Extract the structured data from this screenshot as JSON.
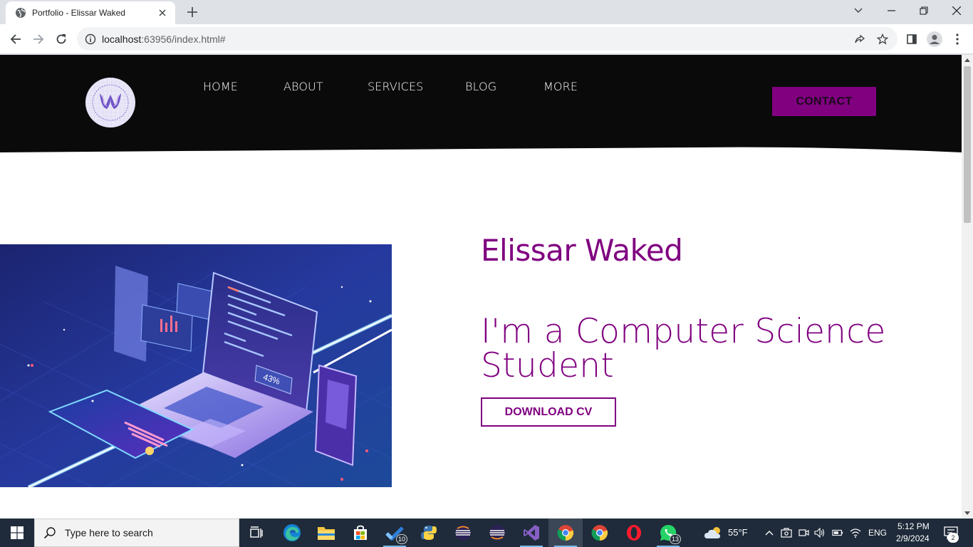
{
  "browser": {
    "tab_title": "Portfolio - Elissar Waked",
    "url_host": "localhost",
    "url_rest": ":63956/index.html#"
  },
  "site": {
    "nav": [
      "HOME",
      "ABOUT",
      "SERVICES",
      "BLOG",
      "MORE"
    ],
    "contact_label": "CONTACT",
    "name": "Elissar Waked",
    "tagline_line1": "I'm a Computer Science",
    "tagline_line2": "Student",
    "cv_label": "DOWNLOAD CV",
    "image_percent": "43%",
    "colors": {
      "accent": "#800080",
      "header_bg": "#0a0a0a"
    }
  },
  "taskbar": {
    "search_placeholder": "Type here to search",
    "badges": {
      "todo": "10",
      "whatsapp": "13",
      "notifications": "2"
    },
    "weather": "55°F",
    "language": "ENG",
    "time": "5:12 PM",
    "date": "2/9/2024"
  }
}
